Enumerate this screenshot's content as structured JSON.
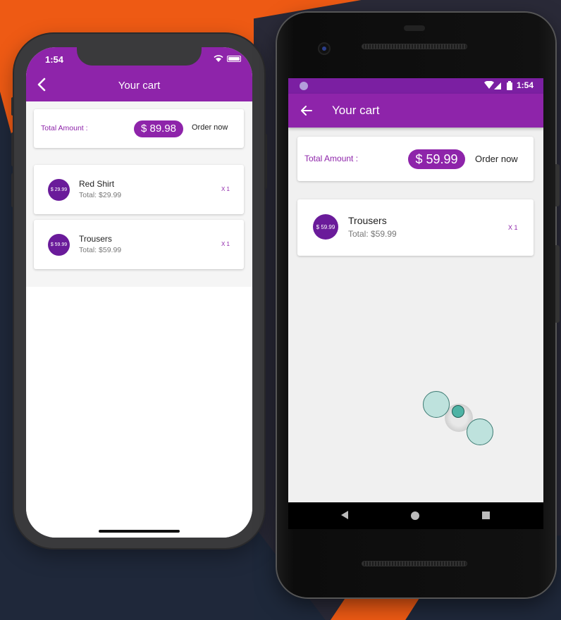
{
  "colors": {
    "primary": "#8e24aa",
    "primary_dark": "#7b1fa2",
    "avatar": "#6a1b9a"
  },
  "ios": {
    "time": "1:54",
    "title": "Your cart",
    "total_label": "Total Amount :",
    "total_value": "$ 89.98",
    "order_label": "Order now",
    "items": [
      {
        "price_badge": "$ 29.99",
        "title": "Red Shirt",
        "subtotal": "Total:  $29.99",
        "qty": "X 1"
      },
      {
        "price_badge": "$ 59.99",
        "title": "Trousers",
        "subtotal": "Total:  $59.99",
        "qty": "X 1"
      }
    ]
  },
  "android": {
    "time": "1:54",
    "title": "Your cart",
    "total_label": "Total Amount :",
    "total_value": "$ 59.99",
    "order_label": "Order now",
    "items": [
      {
        "price_badge": "$ 59.99",
        "title": "Trousers",
        "subtotal": "Total:  $59.99",
        "qty": "X 1"
      }
    ]
  },
  "icons": [
    "back-chevron-icon",
    "wifi-icon",
    "battery-icon",
    "back-arrow-icon",
    "signal-icon",
    "nav-back-icon",
    "nav-home-icon",
    "nav-recents-icon",
    "touch-indicator-icon"
  ]
}
